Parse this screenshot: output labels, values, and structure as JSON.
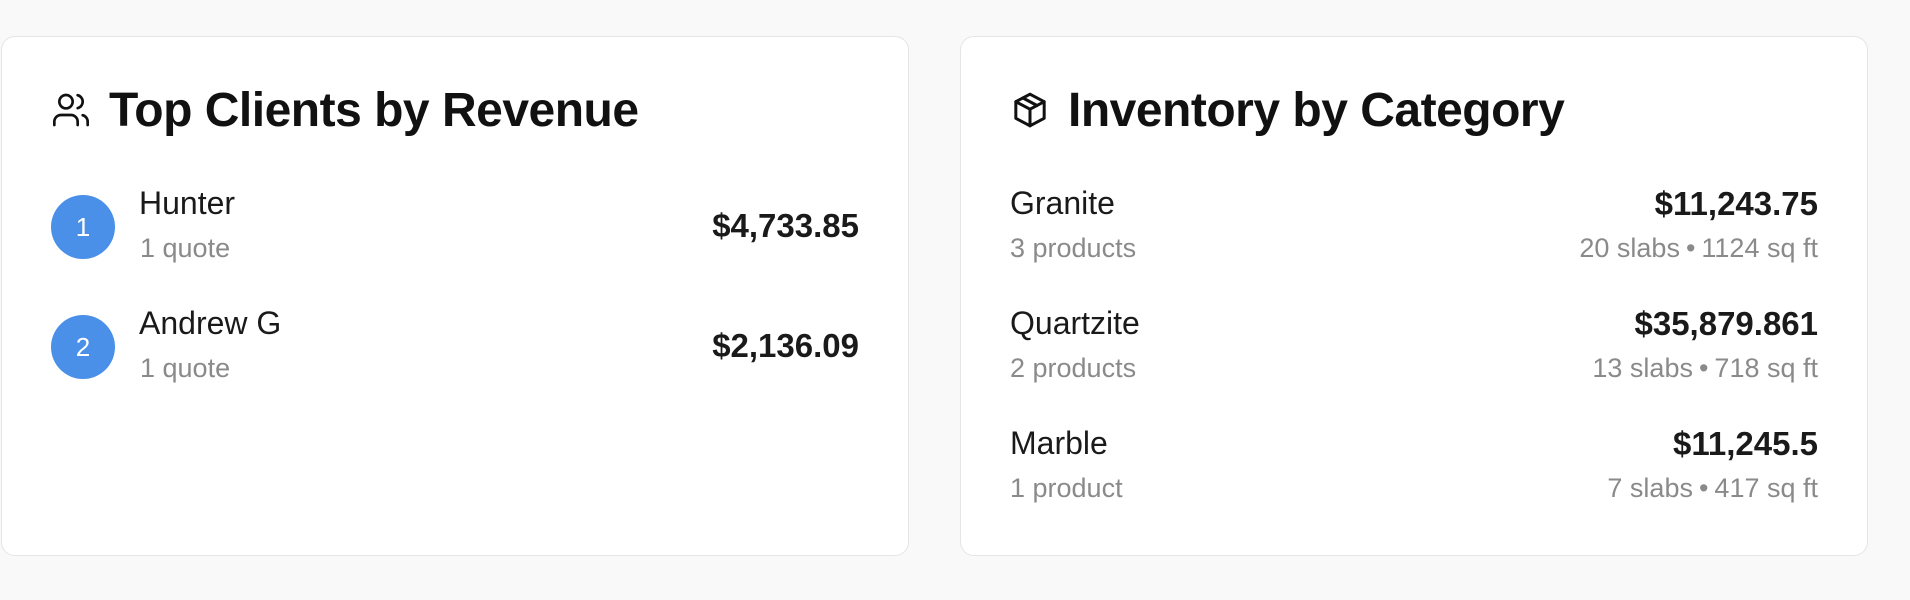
{
  "top_clients": {
    "title": "Top Clients by Revenue",
    "icon": "users-icon",
    "badge_color": "#4a90e8",
    "clients": [
      {
        "rank": "1",
        "name": "Hunter",
        "quotes": "1 quote",
        "revenue": "$4,733.85"
      },
      {
        "rank": "2",
        "name": "Andrew G",
        "quotes": "1 quote",
        "revenue": "$2,136.09"
      }
    ]
  },
  "inventory": {
    "title": "Inventory by Category",
    "icon": "package-icon",
    "categories": [
      {
        "name": "Granite",
        "products": "3 products",
        "value": "$11,243.75",
        "slabs": "20 slabs",
        "separator": "•",
        "area": "1124 sq ft"
      },
      {
        "name": "Quartzite",
        "products": "2 products",
        "value": "$35,879.861",
        "slabs": "13 slabs",
        "separator": "•",
        "area": "718 sq ft"
      },
      {
        "name": "Marble",
        "products": "1 product",
        "value": "$11,245.5",
        "slabs": "7 slabs",
        "separator": "•",
        "area": "417 sq ft"
      }
    ]
  }
}
